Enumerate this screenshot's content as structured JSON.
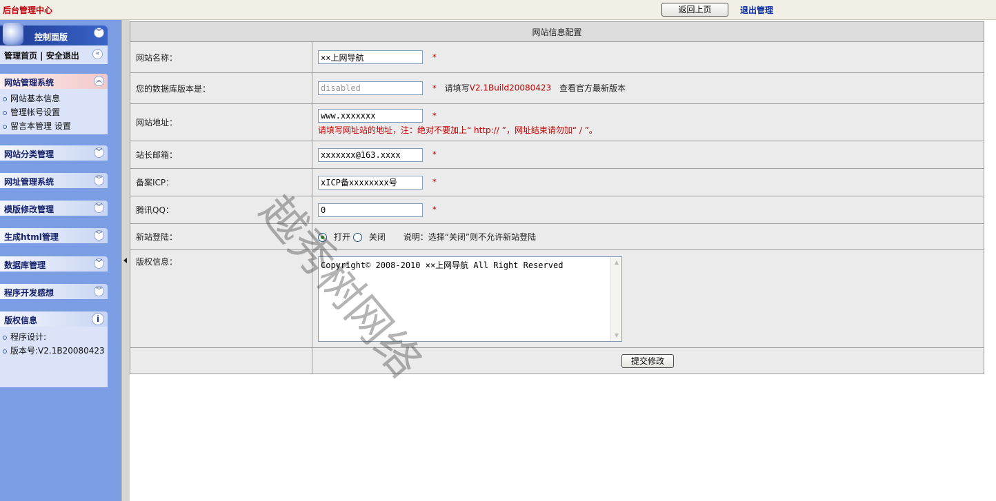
{
  "header": {
    "title": "后台管理中心",
    "back_button": "返回上页",
    "logout": "退出管理"
  },
  "sidebar": {
    "control_panel": {
      "title": "控制面版",
      "links": "管理首页 | 安全退出"
    },
    "site_admin": {
      "title": "网站管理系统",
      "items": [
        "网站基本信息",
        "管理帐号设置",
        "留言本管理 设置"
      ]
    },
    "collapsed_sections": [
      "网站分类管理",
      "网址管理系统",
      "模版修改管理",
      "生成html管理",
      "数据库管理",
      "程序开发感想"
    ],
    "copyright": {
      "title": "版权信息",
      "items": [
        "程序设计:",
        "版本号:V2.1B20080423"
      ]
    }
  },
  "form": {
    "heading": "网站信息配置",
    "site_name": {
      "label": "网站名称：",
      "value": "××上网导航"
    },
    "db_version": {
      "label": "您的数据库版本是：",
      "value": "disabled",
      "hint_prefix": "请填写",
      "hint_version": "V2.1Build20080423",
      "hint_suffix": "查看官方最新版本"
    },
    "site_url": {
      "label": "网站地址：",
      "value": "www.xxxxxxx",
      "note": "请填写网址站的地址，注：绝对不要加上“ http:// ”，网址结束请勿加“ / ”。"
    },
    "email": {
      "label": "站长邮箱：",
      "value": "xxxxxxx@163.xxxx"
    },
    "icp": {
      "label": "备案ICP：",
      "value": "xICP备xxxxxxxx号"
    },
    "qq": {
      "label": "腾讯QQ：",
      "value": "0"
    },
    "new_site_login": {
      "label": "新站登陆：",
      "open": "打开",
      "close": "关闭",
      "note": "说明：选择“关闭”则不允许新站登陆"
    },
    "copyright": {
      "label": "版权信息：",
      "value": "Copyright© 2008-2010 ××上网导航 All Right Reserved"
    },
    "required_mark": "*",
    "submit": "提交修改"
  },
  "watermark": "越秀树网络"
}
